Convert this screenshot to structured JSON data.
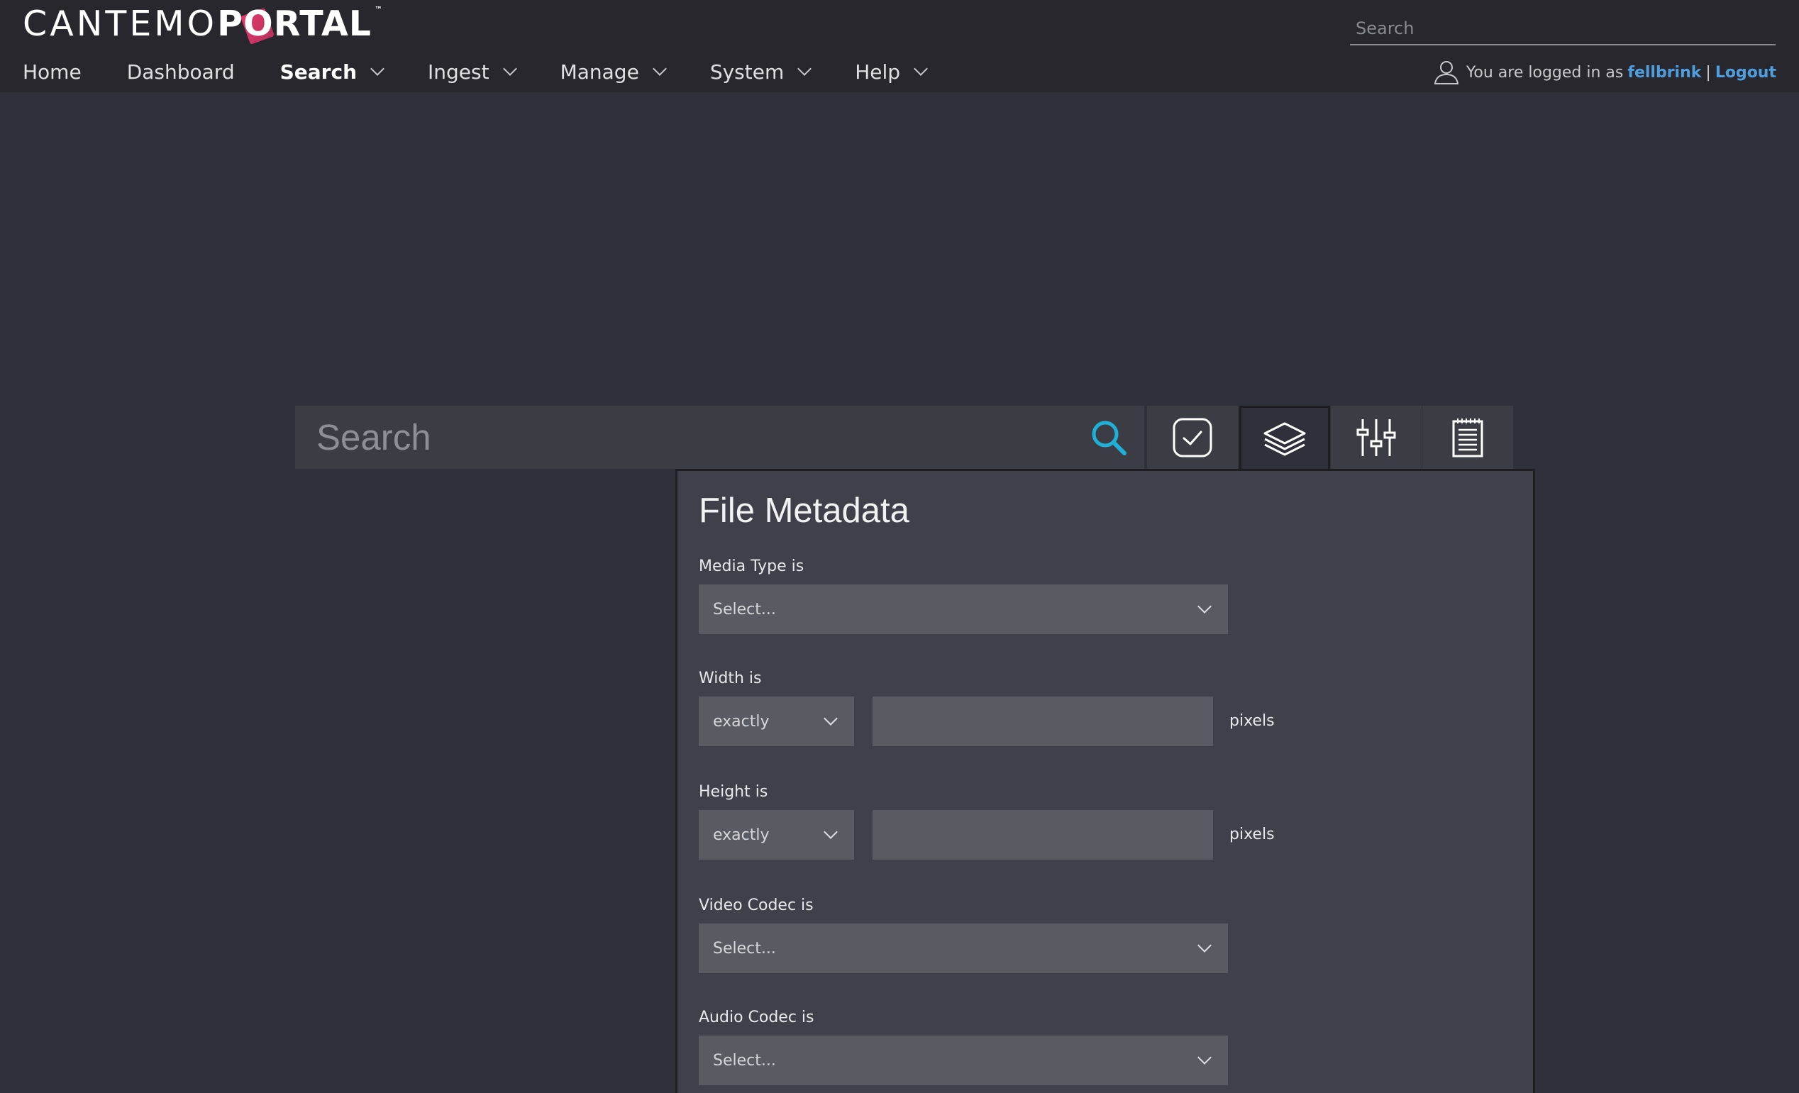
{
  "brand": {
    "light": "CANTEMO",
    "o": "O",
    "bold": "RTAL",
    "p": "P",
    "tm": "™"
  },
  "header": {
    "search_placeholder": "Search"
  },
  "nav": [
    {
      "label": "Home",
      "dropdown": false,
      "active": false
    },
    {
      "label": "Dashboard",
      "dropdown": false,
      "active": false
    },
    {
      "label": "Search",
      "dropdown": true,
      "active": true
    },
    {
      "label": "Ingest",
      "dropdown": true,
      "active": false
    },
    {
      "label": "Manage",
      "dropdown": true,
      "active": false
    },
    {
      "label": "System",
      "dropdown": true,
      "active": false
    },
    {
      "label": "Help",
      "dropdown": true,
      "active": false
    }
  ],
  "login": {
    "prefix": "You are logged in as",
    "username": "fellbrink",
    "separator": "|",
    "logout": "Logout"
  },
  "search": {
    "placeholder": "Search"
  },
  "toolbar": {
    "icons": [
      "search-icon",
      "checkbox-icon",
      "layers-icon",
      "sliders-icon",
      "notepad-icon"
    ],
    "active": "layers-icon"
  },
  "panel": {
    "title": "File Metadata",
    "media_type": {
      "label": "Media Type is",
      "value": "Select..."
    },
    "width": {
      "label": "Width is",
      "operator": "exactly",
      "value": "",
      "unit": "pixels"
    },
    "height": {
      "label": "Height is",
      "operator": "exactly",
      "value": "",
      "unit": "pixels"
    },
    "video_codec": {
      "label": "Video Codec is",
      "value": "Select..."
    },
    "audio_codec": {
      "label": "Audio Codec is",
      "value": "Select..."
    }
  },
  "colors": {
    "accent": "#1fb0d8",
    "link": "#4f9fdf",
    "brand_mark": "#e43a6e",
    "background": "#30303b",
    "header": "#27272d"
  }
}
